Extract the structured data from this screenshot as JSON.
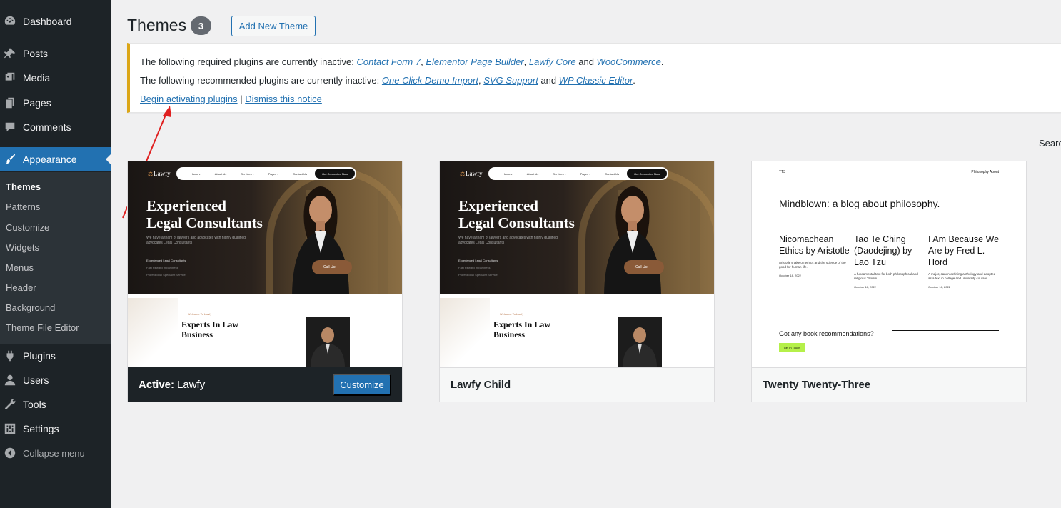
{
  "sidebar": {
    "items": [
      {
        "label": "Dashboard",
        "icon": "dashboard-icon"
      },
      {
        "label": "Posts",
        "icon": "pin-icon"
      },
      {
        "label": "Media",
        "icon": "media-icon"
      },
      {
        "label": "Pages",
        "icon": "pages-icon"
      },
      {
        "label": "Comments",
        "icon": "comment-icon"
      },
      {
        "label": "Appearance",
        "icon": "paintbrush-icon"
      },
      {
        "label": "Plugins",
        "icon": "plugin-icon"
      },
      {
        "label": "Users",
        "icon": "user-icon"
      },
      {
        "label": "Tools",
        "icon": "wrench-icon"
      },
      {
        "label": "Settings",
        "icon": "settings-icon"
      }
    ],
    "submenu": [
      "Themes",
      "Patterns",
      "Customize",
      "Widgets",
      "Menus",
      "Header",
      "Background",
      "Theme File Editor"
    ],
    "collapse_label": "Collapse menu"
  },
  "header": {
    "title": "Themes",
    "count": "3",
    "add_new_label": "Add New Theme"
  },
  "notice": {
    "required_prefix": "The following required plugins are currently inactive: ",
    "required": [
      "Contact Form 7",
      "Elementor Page Builder",
      "Lawfy Core",
      "WooCommerce"
    ],
    "recommended_prefix": "The following recommended plugins are currently inactive: ",
    "recommended": [
      "One Click Demo Import",
      "SVG Support",
      "WP Classic Editor"
    ],
    "sep_comma": ", ",
    "sep_and": " and ",
    "end": ".",
    "begin_link": "Begin activating plugins",
    "pipe": " | ",
    "dismiss_link": "Dismiss this notice"
  },
  "search_label": "Search",
  "themes": [
    {
      "name": "Lawfy",
      "active_label": "Active:",
      "customize_label": "Customize"
    },
    {
      "name": "Lawfy Child"
    },
    {
      "name": "Twenty Twenty-Three"
    }
  ],
  "lawfy_preview": {
    "logo": "Lawfy",
    "nav": [
      "Home ▾",
      "About Us",
      "Services ▾",
      "Pages ▾",
      "Contact Us"
    ],
    "nav_cta": "Get Connected Now",
    "headline_1": "Experienced",
    "headline_2": "Legal Consultants",
    "subtext": "We have a team of lawyers and advocates with highly qualified advocates Legal Consultants",
    "bullets": [
      "Experienced Legal Consultants",
      "Fast Reward In Business",
      "Professional Specialist Service"
    ],
    "call_us": "Call Us:",
    "welcome": "Welcome To Lawfy",
    "experts_1": "Experts In Law",
    "experts_2": "Business"
  },
  "tt3_preview": {
    "site": "TT3",
    "nav": "Philosophy  About",
    "title": "Mindblown: a blog about philosophy.",
    "posts": [
      {
        "title": "Nicomachean Ethics by Aristotle",
        "excerpt": "Aristotle's take on ethics and the science of the good for human life.",
        "date": "October 18, 2022"
      },
      {
        "title": "Tao Te Ching (Daodejing) by Lao Tzu",
        "excerpt": "A fundamental text for both philosophical and religious Taoism.",
        "date": "October 18, 2022"
      },
      {
        "title": "I Am Because We Are by Fred L. Hord",
        "excerpt": "A major, canon-defining anthology and adopted as a text in college and university courses.",
        "date": "October 18, 2022"
      }
    ],
    "question": "Got any book recommendations?",
    "touch": "Get In Touch"
  },
  "colors": {
    "sidebar_bg": "#1d2327",
    "accent": "#2271b1",
    "notice_border": "#dba617",
    "arrow": "#e02020"
  }
}
